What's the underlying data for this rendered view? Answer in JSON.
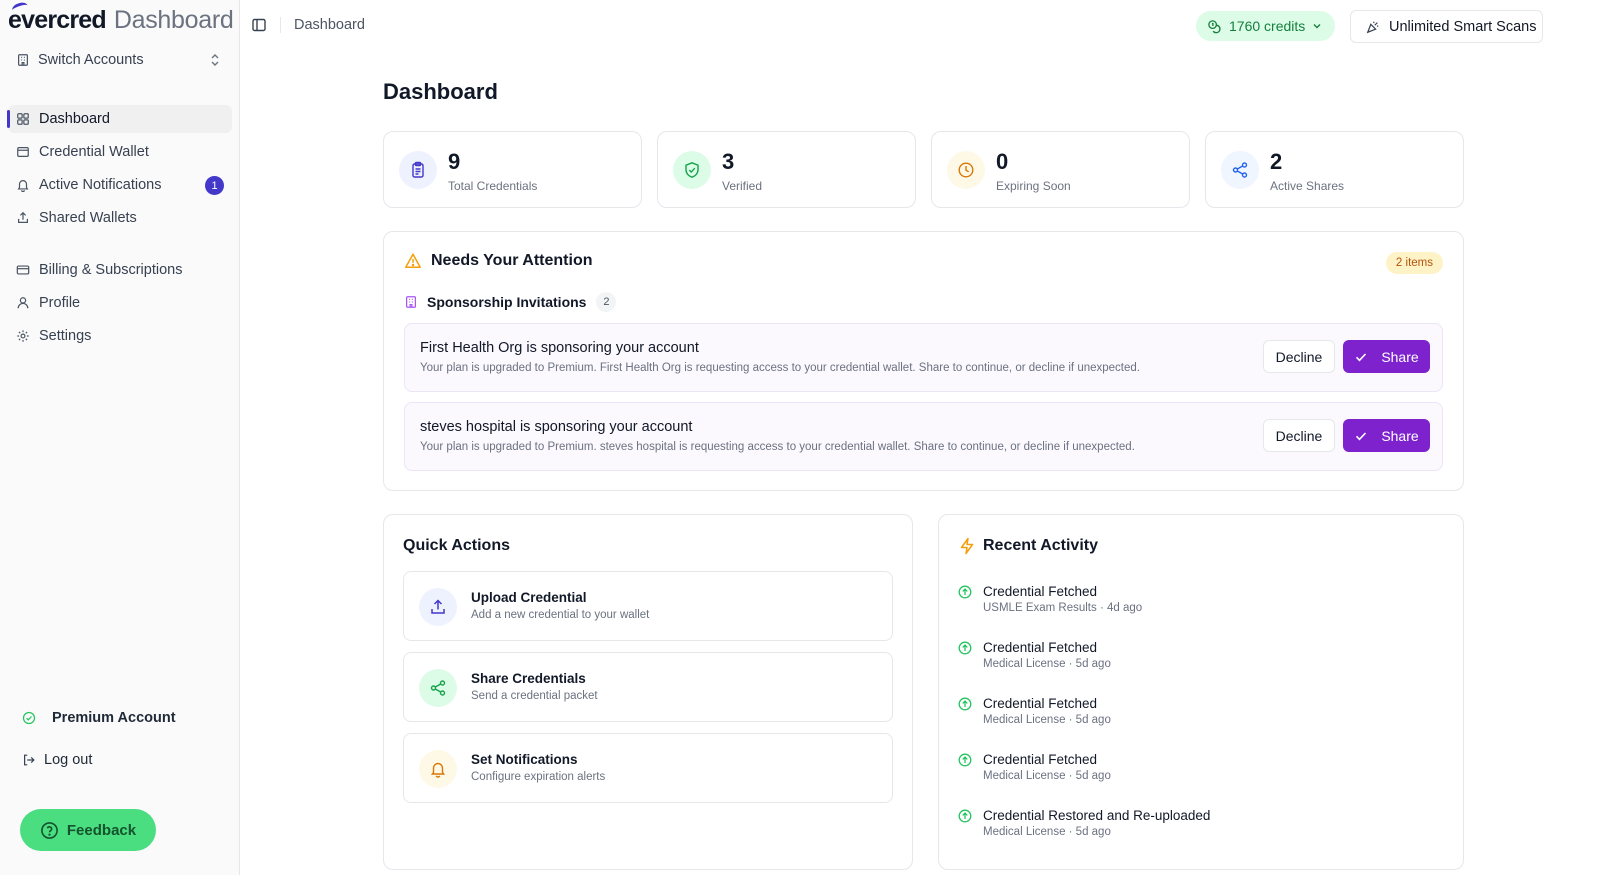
{
  "app": {
    "logo_brand": "evercred",
    "logo_suffix": "Dashboard"
  },
  "sidebar": {
    "switch_label": "Switch Accounts",
    "items": [
      {
        "label": "Dashboard",
        "icon": "grid-icon",
        "active": true
      },
      {
        "label": "Credential Wallet",
        "icon": "wallet-icon"
      },
      {
        "label": "Active Notifications",
        "icon": "bell-icon",
        "badge": "1"
      },
      {
        "label": "Shared Wallets",
        "icon": "upload-icon"
      },
      {
        "label": "Billing & Subscriptions",
        "icon": "card-icon"
      },
      {
        "label": "Profile",
        "icon": "user-icon"
      },
      {
        "label": "Settings",
        "icon": "gear-icon"
      }
    ],
    "premium_label": "Premium Account",
    "logout_label": "Log out",
    "feedback_label": "Feedback"
  },
  "topbar": {
    "breadcrumb": "Dashboard",
    "credits": "1760 credits",
    "smart_scans": "Unlimited Smart Scans"
  },
  "main": {
    "title": "Dashboard",
    "stats": [
      {
        "value": "9",
        "label": "Total Credentials",
        "icon": "clipboard-icon",
        "color": "#4338ca",
        "bg": "#eef2ff"
      },
      {
        "value": "3",
        "label": "Verified",
        "icon": "shield-check-icon",
        "color": "#16a34a",
        "bg": "#dcfce7"
      },
      {
        "value": "0",
        "label": "Expiring Soon",
        "icon": "clock-icon",
        "color": "#d97706",
        "bg": "#fef9e7"
      },
      {
        "value": "2",
        "label": "Active Shares",
        "icon": "share-icon",
        "color": "#2563eb",
        "bg": "#eff6ff"
      }
    ],
    "attention": {
      "title": "Needs Your Attention",
      "pill": "2 items",
      "section_title": "Sponsorship Invitations",
      "section_count": "2",
      "invitations": [
        {
          "title": "First Health Org is sponsoring your account",
          "description": "Your plan is upgraded to Premium. First Health Org is requesting access to your credential wallet. Share to continue, or decline if unexpected.",
          "decline_label": "Decline",
          "share_label": "Share"
        },
        {
          "title": "steves hospital is sponsoring your account",
          "description": "Your plan is upgraded to Premium. steves hospital is requesting access to your credential wallet. Share to continue, or decline if unexpected.",
          "decline_label": "Decline",
          "share_label": "Share"
        }
      ]
    },
    "quick_actions": {
      "title": "Quick Actions",
      "items": [
        {
          "title": "Upload Credential",
          "description": "Add a new credential to your wallet",
          "icon": "upload-icon",
          "color": "#4338ca",
          "bg": "#eef2ff"
        },
        {
          "title": "Share Credentials",
          "description": "Send a credential packet",
          "icon": "share-icon",
          "color": "#16a34a",
          "bg": "#dcfce7"
        },
        {
          "title": "Set Notifications",
          "description": "Configure expiration alerts",
          "icon": "bell-icon",
          "color": "#d97706",
          "bg": "#fef9e7"
        }
      ]
    },
    "recent_activity": {
      "title": "Recent Activity",
      "items": [
        {
          "title": "Credential Fetched",
          "meta": "USMLE Exam Results · 4d ago"
        },
        {
          "title": "Credential Fetched",
          "meta": "Medical License · 5d ago"
        },
        {
          "title": "Credential Fetched",
          "meta": "Medical License · 5d ago"
        },
        {
          "title": "Credential Fetched",
          "meta": "Medical License · 5d ago"
        },
        {
          "title": "Credential Restored and Re-uploaded",
          "meta": "Medical License · 5d ago"
        }
      ]
    }
  }
}
